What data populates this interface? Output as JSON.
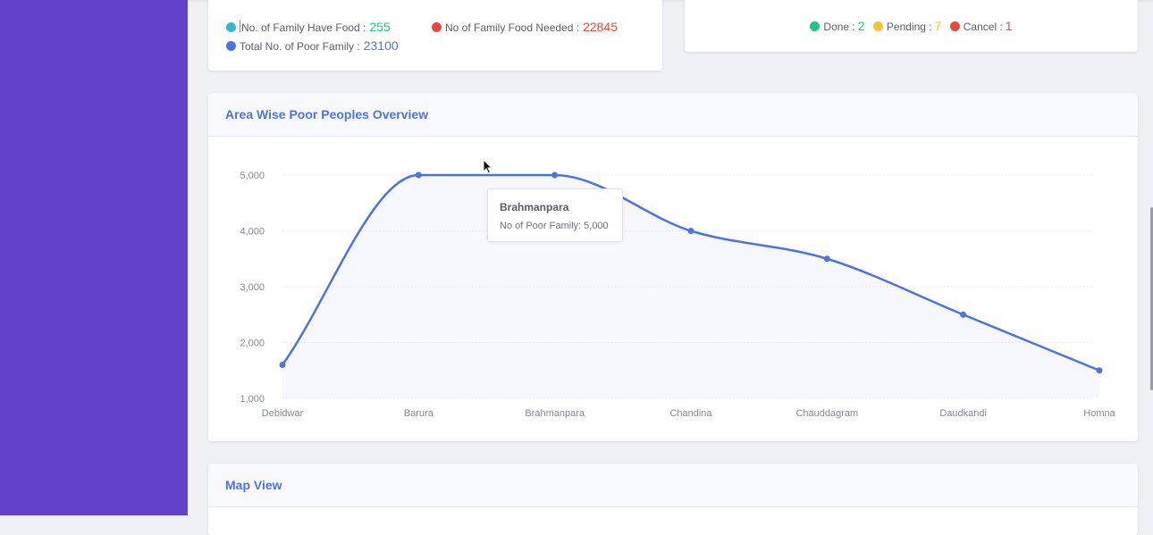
{
  "stats": {
    "family_have_food": {
      "label": "No. of Family Have Food :",
      "value": "255",
      "color": "#36b9cc",
      "value_color": "#1cc88a"
    },
    "family_food_needed": {
      "label": "No of Family Food Needed :",
      "value": "22845",
      "color": "#e74a3b",
      "value_color": "#e74a3b"
    },
    "total_poor_family": {
      "label": "Total No. of Poor Family :",
      "value": "23100",
      "color": "#4e73df",
      "value_color": "#4e73df"
    }
  },
  "status": {
    "done": {
      "label": "Done :",
      "value": "2",
      "color": "#1cc88a"
    },
    "pending": {
      "label": "Pending :",
      "value": "7",
      "color": "#f6c23e"
    },
    "cancel": {
      "label": "Cancel :",
      "value": "1",
      "color": "#e74a3b"
    }
  },
  "overview_card": {
    "title": "Area Wise Poor Peoples Overview"
  },
  "map_card": {
    "title": "Map View"
  },
  "tooltip": {
    "title": "Brahmanpara",
    "body": "No of Poor Family: 5,000"
  },
  "chart_data": {
    "type": "area",
    "title": "",
    "categories": [
      "Debidwar",
      "Barura",
      "Brahmanpara",
      "Chandina",
      "Chauddagram",
      "Daudkandi",
      "Homna"
    ],
    "series": [
      {
        "name": "No of Poor Family",
        "values": [
          1600,
          5000,
          5000,
          4000,
          3500,
          2500,
          1500
        ],
        "color": "#4e73df"
      }
    ],
    "ylim": [
      1000,
      5000
    ],
    "yticks": [
      1000,
      2000,
      3000,
      4000,
      5000
    ],
    "ytick_labels": [
      "1,000",
      "2,000",
      "3,000",
      "4,000",
      "5,000"
    ],
    "grid": true
  },
  "colors": {
    "sidebar": "#6242c9",
    "accent": "#4e73df"
  }
}
